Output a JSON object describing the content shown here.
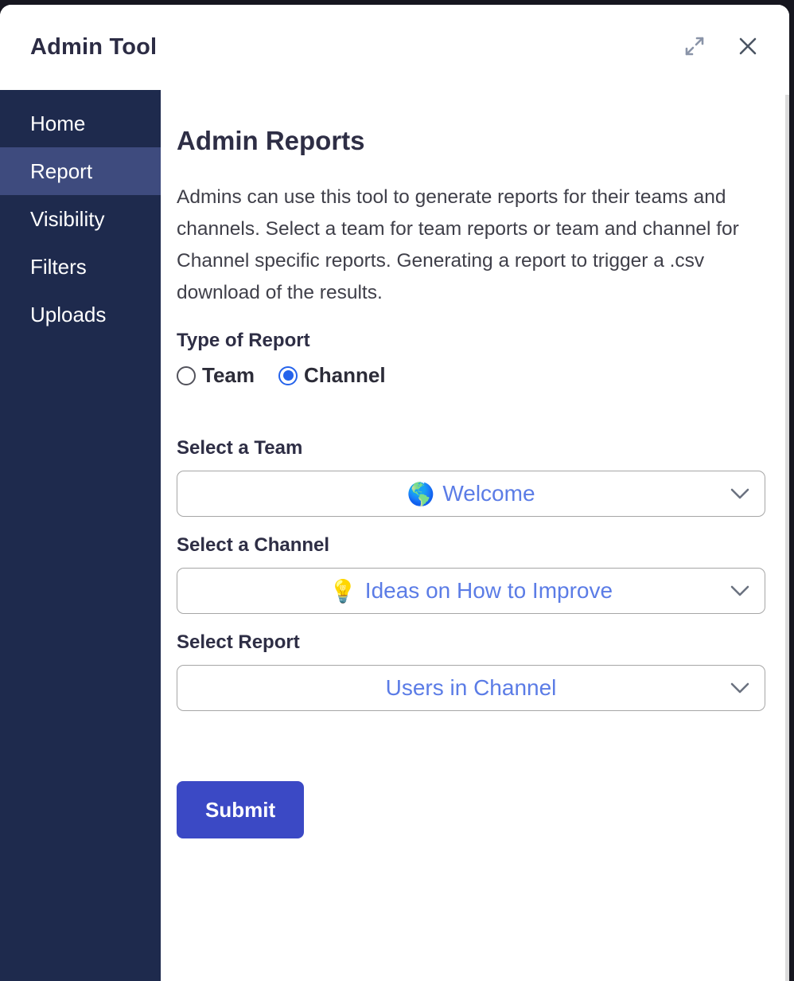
{
  "window": {
    "title": "Admin Tool"
  },
  "sidebar": {
    "items": [
      {
        "label": "Home",
        "active": false
      },
      {
        "label": "Report",
        "active": true
      },
      {
        "label": "Visibility",
        "active": false
      },
      {
        "label": "Filters",
        "active": false
      },
      {
        "label": "Uploads",
        "active": false
      }
    ]
  },
  "main": {
    "title": "Admin Reports",
    "description": "Admins can use this tool to generate reports for their teams and channels. Select a team for team reports or team and channel for Channel specific reports. Generating a report to trigger a .csv download of the results.",
    "report_type": {
      "label": "Type of Report",
      "options": [
        {
          "label": "Team",
          "selected": false
        },
        {
          "label": "Channel",
          "selected": true
        }
      ]
    },
    "team_select": {
      "label": "Select a Team",
      "icon": "🌎",
      "value": "Welcome"
    },
    "channel_select": {
      "label": "Select a Channel",
      "icon": "💡",
      "value": "Ideas on How to Improve"
    },
    "report_select": {
      "label": "Select Report",
      "icon": "",
      "value": "Users in Channel"
    },
    "submit_label": "Submit"
  },
  "colors": {
    "sidebar_bg": "#1e2a4d",
    "sidebar_active": "#3e4b7e",
    "accent_blue": "#5b7ce6",
    "submit_bg": "#3b49c5",
    "radio_selected": "#2563eb"
  }
}
